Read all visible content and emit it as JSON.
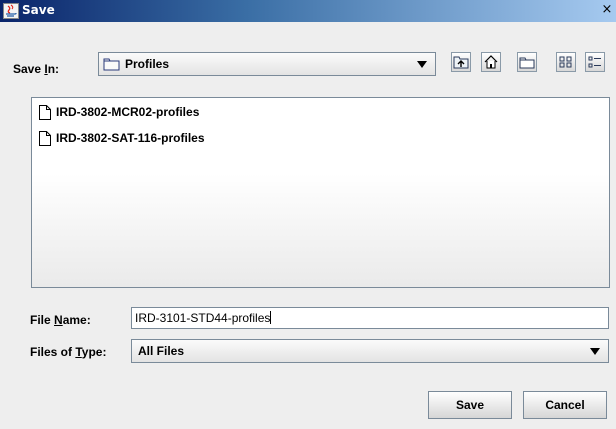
{
  "window": {
    "title": "Save",
    "close_glyph": "×"
  },
  "save_in": {
    "label_prefix": "Save ",
    "label_mnemonic": "I",
    "label_suffix": "n:",
    "value": "Profiles",
    "icon": "folder-icon"
  },
  "toolbar": {
    "buttons": [
      {
        "name": "up-one-level-button",
        "icon": "folder-up-icon"
      },
      {
        "name": "home-button",
        "icon": "home-icon"
      },
      {
        "name": "new-folder-button",
        "icon": "new-folder-icon"
      },
      {
        "name": "list-view-button",
        "icon": "list-view-icon"
      },
      {
        "name": "details-view-button",
        "icon": "details-view-icon"
      }
    ]
  },
  "files": [
    {
      "name": "IRD-3802-MCR02-profiles",
      "icon": "file-icon"
    },
    {
      "name": "IRD-3802-SAT-116-profiles",
      "icon": "file-icon"
    }
  ],
  "file_name": {
    "label_prefix": "File ",
    "label_mnemonic": "N",
    "label_suffix": "ame:",
    "value": "IRD-3101-STD44-profiles"
  },
  "file_type": {
    "label_prefix": "Files of ",
    "label_mnemonic": "T",
    "label_suffix": "ype:",
    "value": "All Files"
  },
  "buttons": {
    "save": "Save",
    "cancel": "Cancel"
  },
  "colors": {
    "title_start": "#0a246a",
    "title_end": "#a6caf0",
    "panel": "#eeeeee"
  }
}
